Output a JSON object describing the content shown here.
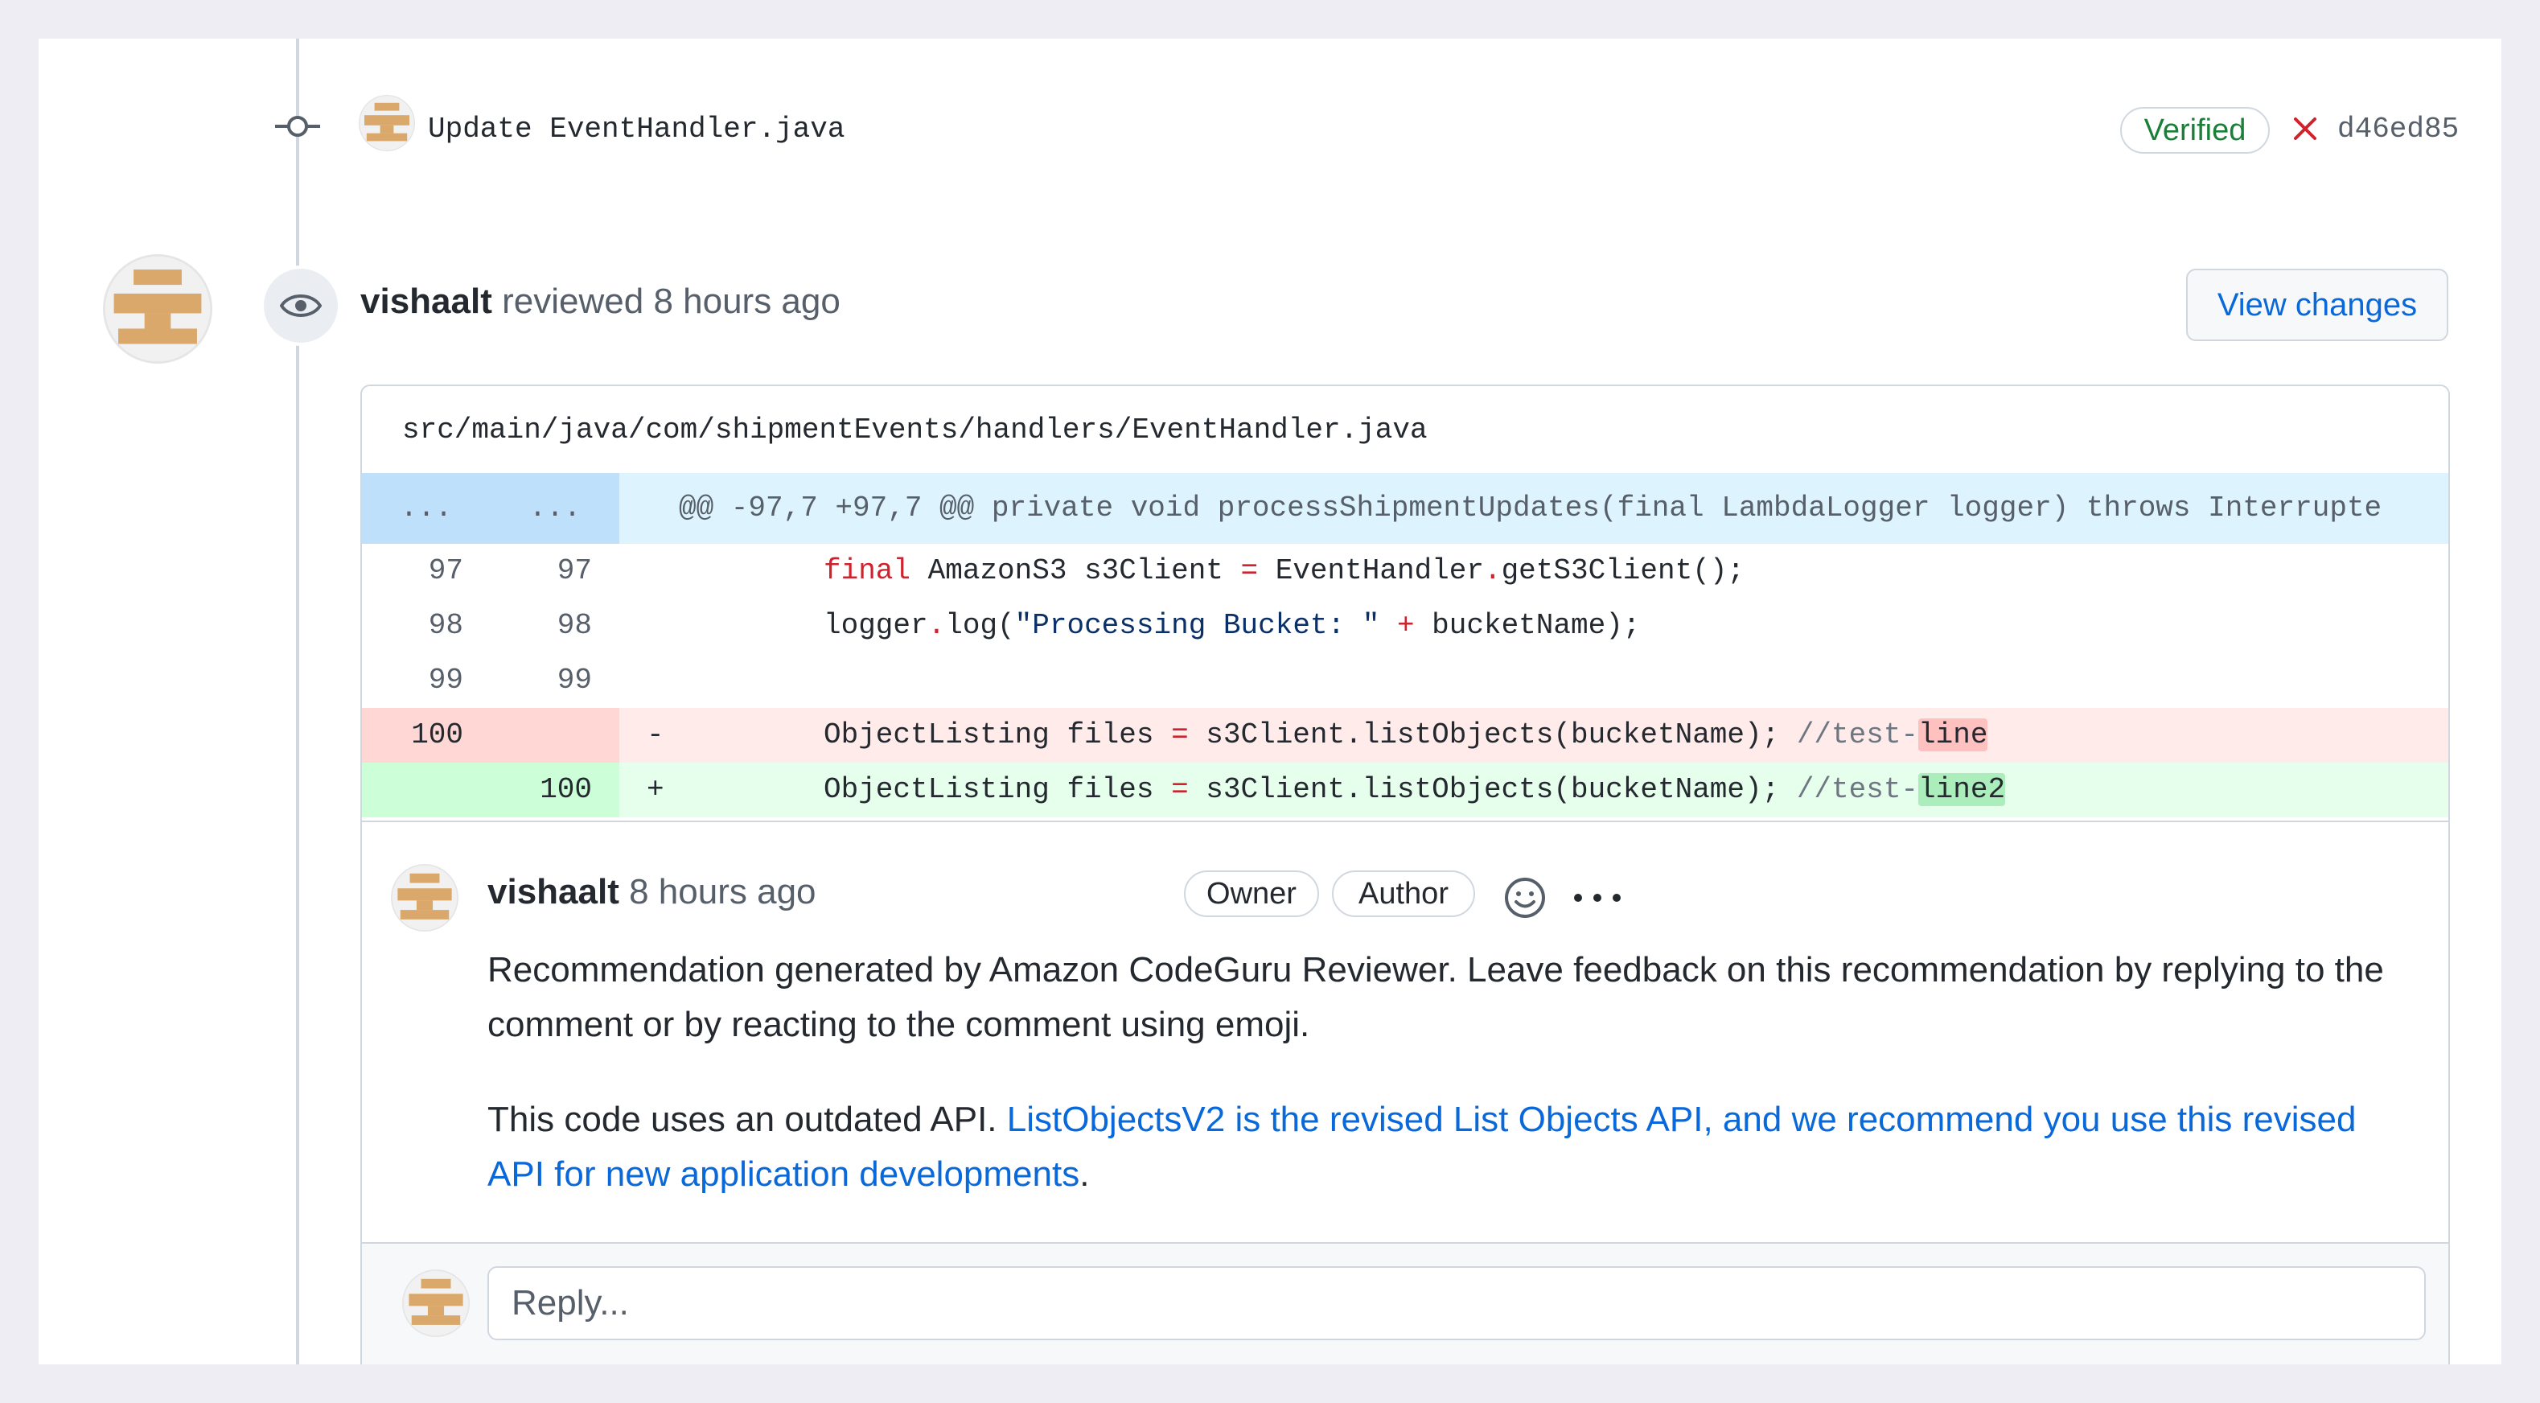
{
  "commit": {
    "message": "Update EventHandler.java",
    "verified_label": "Verified",
    "sha": "d46ed85",
    "status_icon": "x-icon",
    "status_color": "#cf222e"
  },
  "review": {
    "author": "vishaalt",
    "action": "reviewed",
    "time": "8 hours ago",
    "view_changes_label": "View changes"
  },
  "file": {
    "path": "src/main/java/com/shipmentEvents/handlers/EventHandler.java",
    "hunk": {
      "old_marker": "...",
      "new_marker": "...",
      "header": "@@ -97,7 +97,7 @@ private void processShipmentUpdates(final LambdaLogger logger) throws Interrupte"
    },
    "lines": [
      {
        "old": "97",
        "new": "97",
        "type": "context"
      },
      {
        "old": "98",
        "new": "98",
        "type": "context"
      },
      {
        "old": "99",
        "new": "99",
        "type": "context"
      },
      {
        "old": "100",
        "new": "",
        "type": "deleted",
        "marker": "-"
      },
      {
        "old": "",
        "new": "100",
        "type": "added",
        "marker": "+"
      }
    ],
    "code_tokens": {
      "l97_kw": "final",
      "l97_rest1": " AmazonS3 s3Client ",
      "l97_op": "=",
      "l97_rest2": " EventHandler",
      "l97_op2": ".",
      "l97_rest3": "getS3Client();",
      "l98_a": "logger",
      "l98_op": ".",
      "l98_b": "log(",
      "l98_str": "\"Processing Bucket: \"",
      "l98_op2": " + ",
      "l98_c": "bucketName);",
      "del_a": "ObjectListing files ",
      "del_op": "=",
      "del_b": " s3Client.listObjects(bucketName); ",
      "del_cm": "//test-",
      "del_hl": "line",
      "add_a": "ObjectListing files ",
      "add_op": "=",
      "add_b": " s3Client.listObjects(bucketName); ",
      "add_cm": "//test-",
      "add_hl": "line2"
    }
  },
  "comment": {
    "author": "vishaalt",
    "time": "8 hours ago",
    "badges": [
      "Owner",
      "Author"
    ],
    "paragraph1": "Recommendation generated by Amazon CodeGuru Reviewer. Leave feedback on this recommendation by replying to the comment or by reacting to the comment using emoji.",
    "paragraph2_prefix": "This code uses an outdated API. ",
    "paragraph2_link": "ListObjectsV2 is the revised List Objects API, and we recommend you use this revised API for new application developments",
    "paragraph2_suffix": "."
  },
  "reply": {
    "placeholder": "Reply..."
  },
  "colors": {
    "link": "#0969da",
    "verified": "#1a7f37",
    "avatar": "#d9a86a",
    "hunk_bg": "#ddf4ff",
    "deleted_bg": "#ffebe9",
    "added_bg": "#e6ffec"
  }
}
